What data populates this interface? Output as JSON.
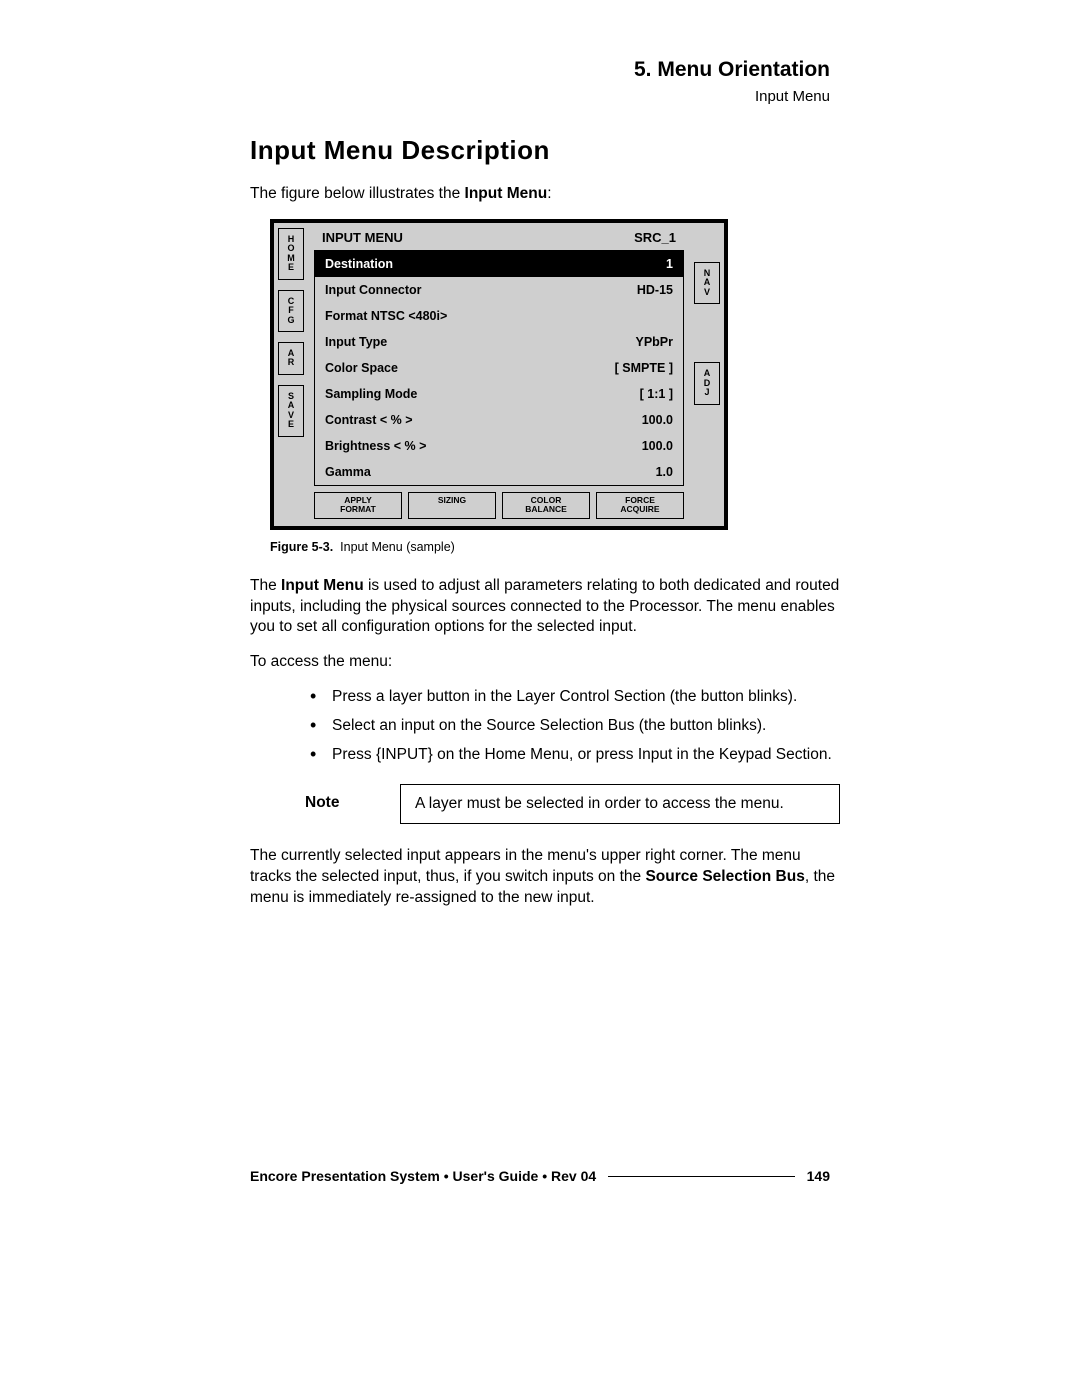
{
  "header": {
    "chapter": "5.  Menu Orientation",
    "section": "Input Menu"
  },
  "title": "Input Menu Description",
  "intro_pre": "The figure below illustrates the ",
  "intro_bold": "Input Menu",
  "intro_post": ":",
  "menu": {
    "left_tabs": [
      "HOME",
      "CFG",
      "AR",
      "SAVE"
    ],
    "right_tabs": [
      "NAV",
      "ADJ"
    ],
    "title_left": "INPUT MENU",
    "title_right": "SRC_1",
    "rows": [
      {
        "label": "Destination",
        "value": "1",
        "selected": true
      },
      {
        "label": "Input Connector",
        "value": "HD-15"
      },
      {
        "label": "Format   NTSC <480i>",
        "value": ""
      },
      {
        "label": "Input Type",
        "value": "YPbPr"
      },
      {
        "label": "Color Space",
        "value": "[ SMPTE ]"
      },
      {
        "label": "Sampling Mode",
        "value": "[ 1:1 ]"
      },
      {
        "label": "Contrast  < % >",
        "value": "100.0"
      },
      {
        "label": "Brightness  < % >",
        "value": "100.0"
      },
      {
        "label": "Gamma",
        "value": "1.0"
      }
    ],
    "softkeys": [
      "APPLY FORMAT",
      "SIZING",
      "COLOR BALANCE",
      "FORCE ACQUIRE"
    ]
  },
  "figure": {
    "label": "Figure 5-3.",
    "caption": "Input Menu  (sample)"
  },
  "para1": {
    "a": "The ",
    "b": "Input Menu",
    "c": " is used to adjust all parameters relating to both dedicated and routed inputs, including the physical sources connected to the Processor.  The menu enables you to set all configuration options for the selected input."
  },
  "access_intro": "To access the menu:",
  "bullets": [
    {
      "a": "Press a layer button in the ",
      "b": "Layer Control Section",
      "c": " (the button blinks)."
    },
    {
      "a": "Select an input on the ",
      "b": "Source Selection Bus",
      "c": " (the button blinks)."
    },
    {
      "a": "Press ",
      "b": "{INPUT}",
      "c": " on the ",
      "d": "Home Menu",
      "e": ", or press ",
      "f": "Input",
      "g": " in the ",
      "h": "Keypad Section",
      "i": "."
    }
  ],
  "note": {
    "label": "Note",
    "text": "A layer must be selected in order to access the menu."
  },
  "para2": {
    "a": "The currently selected input appears in the menu's upper right corner.  The menu tracks the selected input, thus, if you switch inputs on the ",
    "b": "Source Selection Bus",
    "c": ", the menu is immediately re-assigned to the new input."
  },
  "footer": {
    "left": "Encore Presentation System  •  User's Guide  •  Rev 04",
    "page": "149"
  }
}
